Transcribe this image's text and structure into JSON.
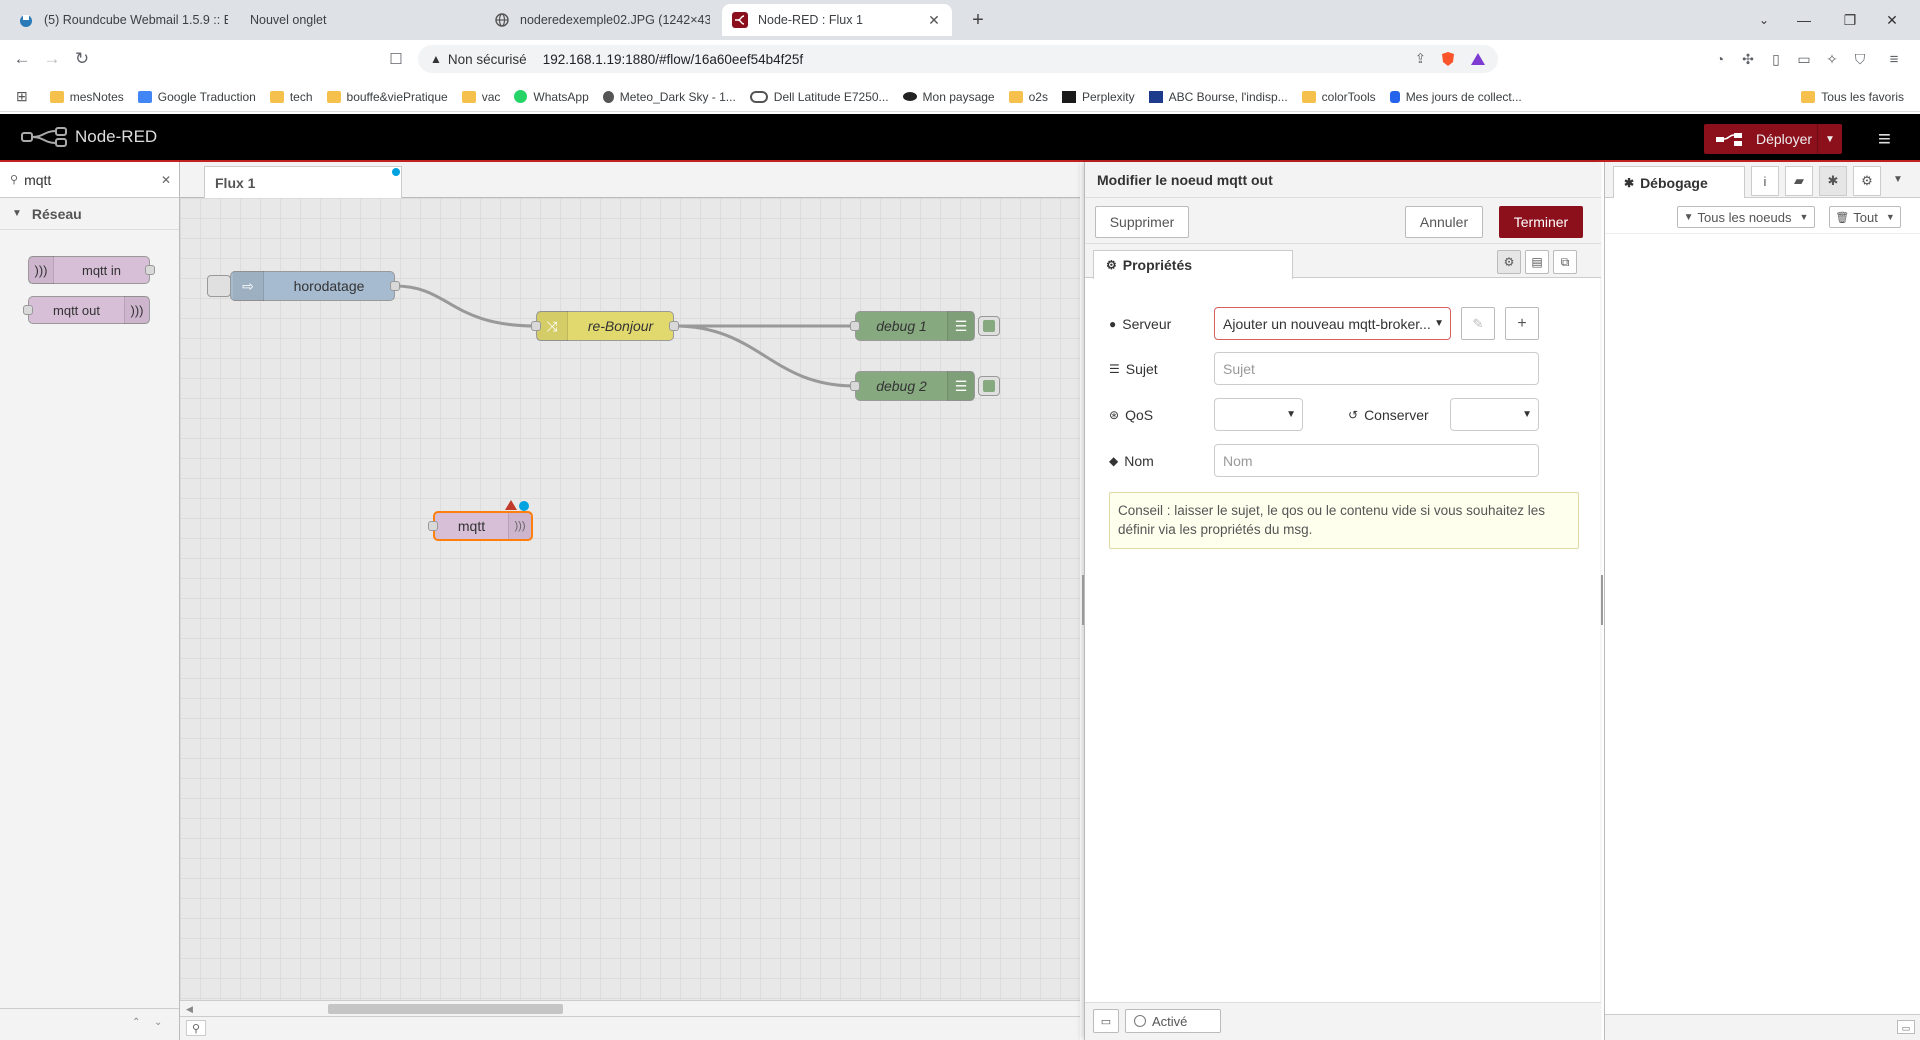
{
  "browser": {
    "tabs": [
      {
        "title": "(5) Roundcube Webmail 1.5.9 :: Bolt",
        "active": false
      },
      {
        "title": "Nouvel onglet",
        "active": false
      },
      {
        "title": "noderedexemple02.JPG (1242×431)",
        "active": false
      },
      {
        "title": "Node-RED : Flux 1",
        "active": true
      }
    ],
    "security_label": "Non sécurisé",
    "url": "192.168.1.19:1880/#flow/16a60eef54b4f25f",
    "bookmarks": [
      {
        "label": "mesNotes",
        "icon": "folder-icon"
      },
      {
        "label": "Google Traduction",
        "icon": "translate-icon"
      },
      {
        "label": "tech",
        "icon": "folder-icon"
      },
      {
        "label": "bouffe&viePratique",
        "icon": "folder-icon"
      },
      {
        "label": "vac",
        "icon": "folder-icon"
      },
      {
        "label": "WhatsApp",
        "icon": "whatsapp-icon"
      },
      {
        "label": "Meteo_Dark Sky - 1...",
        "icon": "apple-icon"
      },
      {
        "label": "Dell Latitude E7250...",
        "icon": "link-icon"
      },
      {
        "label": "Mon paysage",
        "icon": "eye-icon"
      },
      {
        "label": "o2s",
        "icon": "folder-icon"
      },
      {
        "label": "Perplexity",
        "icon": "perplexity-icon"
      },
      {
        "label": "ABC Bourse, l'indisp...",
        "icon": "abc-icon"
      },
      {
        "label": "colorTools",
        "icon": "folder-icon"
      },
      {
        "label": "Mes jours de collect...",
        "icon": "s-icon"
      }
    ],
    "all_favorites": "Tous les favoris"
  },
  "header": {
    "app_name": "Node-RED",
    "deploy_label": "Déployer"
  },
  "palette": {
    "search_value": "mqtt",
    "category": "Réseau",
    "nodes": [
      "mqtt in",
      "mqtt out"
    ]
  },
  "workspace": {
    "tab_label": "Flux 1",
    "nodes": {
      "inject": "horodatage",
      "change": "re-Bonjour",
      "debug1": "debug 1",
      "debug2": "debug 2",
      "mqtt": "mqtt"
    }
  },
  "tray": {
    "title": "Modifier le noeud mqtt out",
    "delete_label": "Supprimer",
    "cancel_label": "Annuler",
    "done_label": "Terminer",
    "properties_tab": "Propriétés",
    "server_label": "Serveur",
    "server_value": "Ajouter un nouveau mqtt-broker...",
    "topic_label": "Sujet",
    "topic_placeholder": "Sujet",
    "qos_label": "QoS",
    "retain_label": "Conserver",
    "name_label": "Nom",
    "name_placeholder": "Nom",
    "tip": "Conseil : laisser le sujet, le qos ou le contenu vide si vous souhaitez les définir via les propriétés du msg.",
    "enabled_label": "Activé"
  },
  "sidebar": {
    "debug_tab": "Débogage",
    "filter_label": "Tous les noeuds",
    "clear_label": "Tout"
  },
  "colors": {
    "accent": "#8c101c",
    "deploy_bg": "#8c101c",
    "header_bg": "#000000",
    "mqtt_node": "#d8bfd8",
    "inject_node": "#a6bbcf",
    "change_node": "#e2d96e",
    "debug_node": "#87a980"
  }
}
